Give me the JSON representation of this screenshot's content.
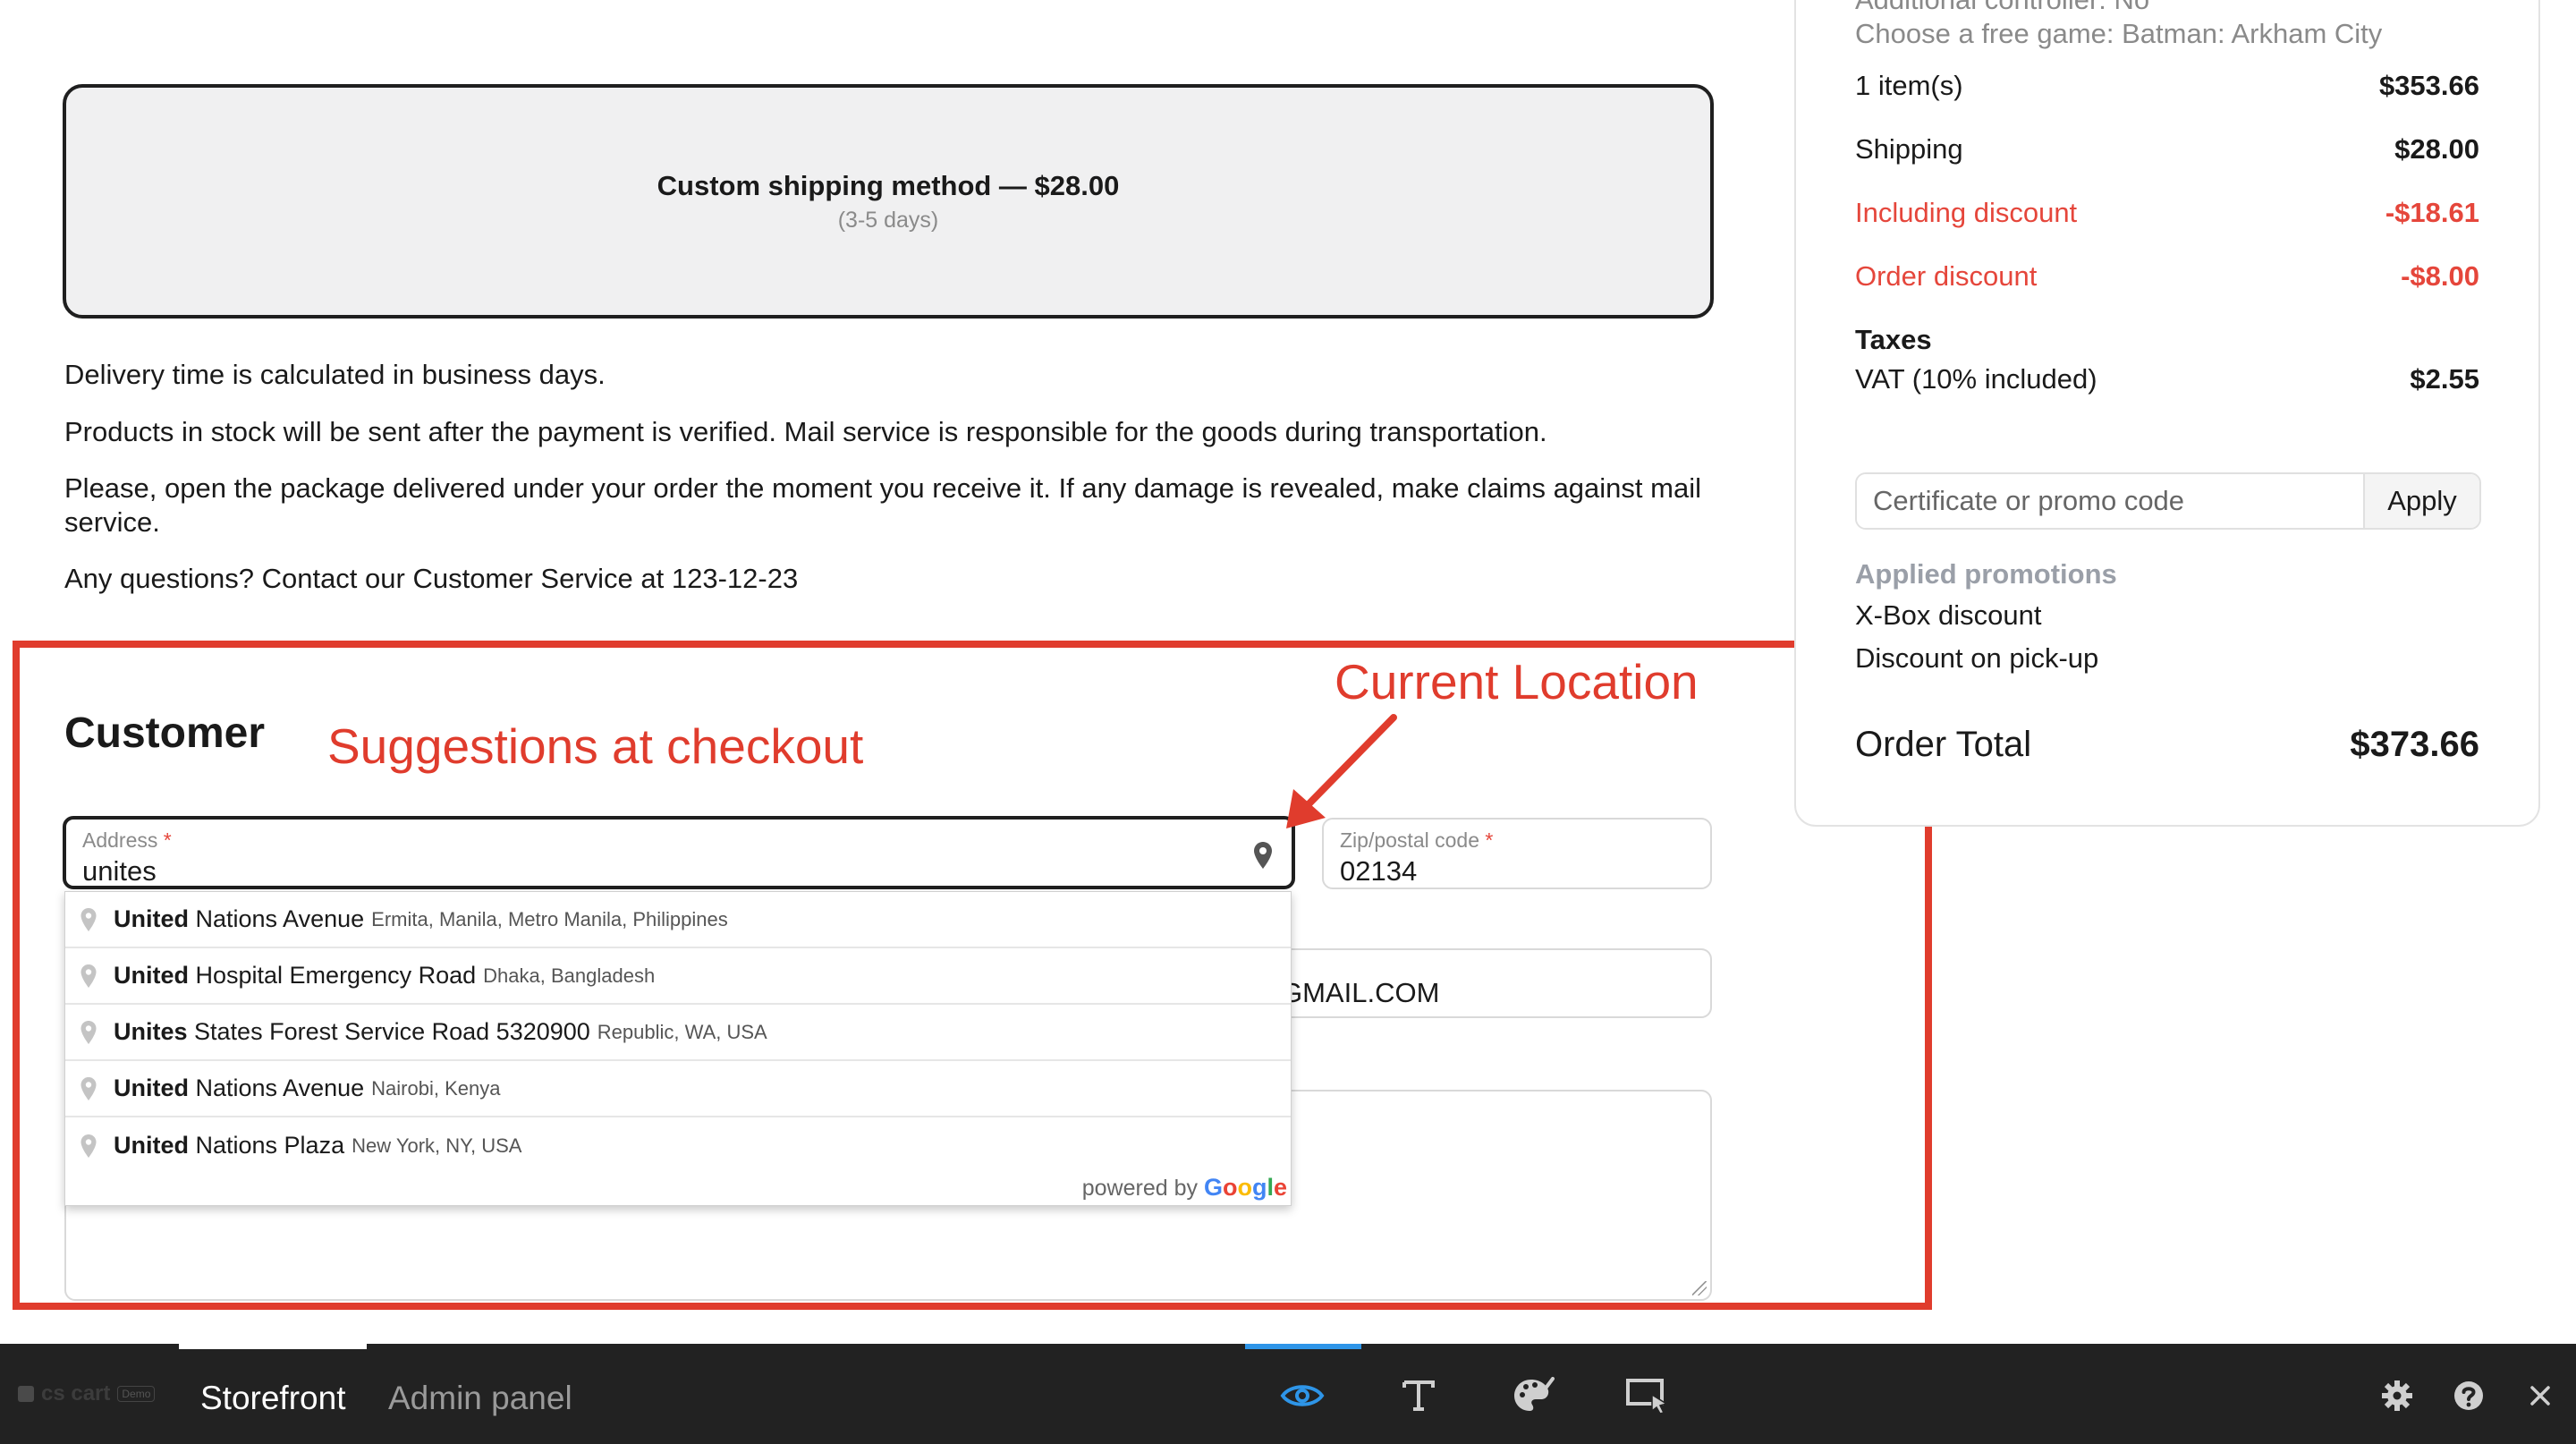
{
  "shipping": {
    "method_label": "Custom shipping method — $28.00",
    "days": "(3-5 days)"
  },
  "info": [
    "Delivery time is calculated in business days.",
    "Products in stock will be sent after the payment is verified. Mail service is responsible for the goods during transportation.",
    "Please, open the package delivered under your order the moment you receive it. If any damage is revealed, make claims against mail service.",
    "Any questions? Contact our Customer Service at 123-12-23"
  ],
  "customer": {
    "heading": "Customer",
    "address": {
      "label": "Address",
      "required": "*",
      "value": "unites"
    },
    "zip": {
      "label": "Zip/postal code",
      "required": "*",
      "value": "02134"
    },
    "email_partial": "GMAIL.COM"
  },
  "suggestions": [
    {
      "match": "United",
      "rest": " Nations Avenue",
      "secondary": "Ermita, Manila, Metro Manila, Philippines"
    },
    {
      "match": "United",
      "rest": " Hospital Emergency Road",
      "secondary": "Dhaka, Bangladesh"
    },
    {
      "match": "Unites",
      "rest": " States Forest Service Road 5320900",
      "secondary": "Republic, WA, USA"
    },
    {
      "match": "United",
      "rest": " Nations Avenue",
      "secondary": "Nairobi, Kenya"
    },
    {
      "match": "United",
      "rest": " Nations Plaza",
      "secondary": "New York, NY, USA"
    }
  ],
  "powered_by": "powered by",
  "google_letters": [
    "G",
    "o",
    "o",
    "g",
    "l",
    "e"
  ],
  "annotations": {
    "suggestions": "Suggestions at checkout",
    "current_location": "Current Location",
    "color": "#e03c2d"
  },
  "summary": {
    "option_line_1": "Additional controller: No",
    "option_line_2": "Choose a free game: Batman: Arkham City",
    "items_label": "1 item(s)",
    "items_value": "$353.66",
    "shipping_label": "Shipping",
    "shipping_value": "$28.00",
    "incl_discount_label": "Including discount",
    "incl_discount_value": "-$18.61",
    "order_discount_label": "Order discount",
    "order_discount_value": "-$8.00",
    "taxes_heading": "Taxes",
    "vat_label": "VAT (10% included)",
    "vat_value": "$2.55",
    "promo_placeholder": "Certificate or promo code",
    "apply_label": "Apply",
    "applied_heading": "Applied promotions",
    "applied": [
      "X-Box discount",
      "Discount on pick-up"
    ],
    "total_label": "Order Total",
    "total_value": "$373.66",
    "discount_color": "#e5463b"
  },
  "toolbar": {
    "logo": "cs cart",
    "logo_badge": "Demo",
    "tabs": [
      "Storefront",
      "Admin panel"
    ],
    "active_tab": "Storefront",
    "icons": [
      "eye-icon",
      "text-icon",
      "palette-icon",
      "select-area-icon",
      "gear-icon",
      "help-icon",
      "close-icon"
    ],
    "accent": "#2e95e8"
  }
}
